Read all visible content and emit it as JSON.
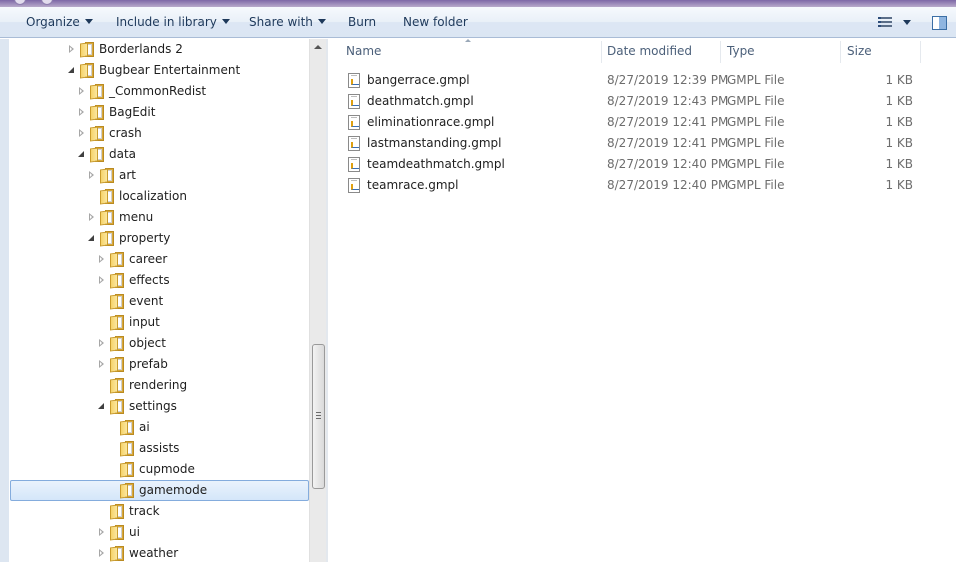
{
  "toolbar": {
    "organize": "Organize",
    "include_in_library": "Include in library",
    "share_with": "Share with",
    "burn": "Burn",
    "new_folder": "New folder"
  },
  "nav": {
    "items": [
      {
        "label": "Borderlands 2",
        "level": 0,
        "expander": "closed",
        "selected": false
      },
      {
        "label": "Bugbear Entertainment",
        "level": 0,
        "expander": "open",
        "selected": false
      },
      {
        "label": "_CommonRedist",
        "level": 1,
        "expander": "closed",
        "selected": false
      },
      {
        "label": "BagEdit",
        "level": 1,
        "expander": "closed",
        "selected": false
      },
      {
        "label": "crash",
        "level": 1,
        "expander": "closed",
        "selected": false
      },
      {
        "label": "data",
        "level": 1,
        "expander": "open",
        "selected": false
      },
      {
        "label": "art",
        "level": 2,
        "expander": "closed",
        "selected": false
      },
      {
        "label": "localization",
        "level": 2,
        "expander": "none",
        "selected": false
      },
      {
        "label": "menu",
        "level": 2,
        "expander": "closed",
        "selected": false
      },
      {
        "label": "property",
        "level": 2,
        "expander": "open",
        "selected": false
      },
      {
        "label": "career",
        "level": 3,
        "expander": "closed",
        "selected": false
      },
      {
        "label": "effects",
        "level": 3,
        "expander": "closed",
        "selected": false
      },
      {
        "label": "event",
        "level": 3,
        "expander": "none",
        "selected": false
      },
      {
        "label": "input",
        "level": 3,
        "expander": "none",
        "selected": false
      },
      {
        "label": "object",
        "level": 3,
        "expander": "closed",
        "selected": false
      },
      {
        "label": "prefab",
        "level": 3,
        "expander": "closed",
        "selected": false
      },
      {
        "label": "rendering",
        "level": 3,
        "expander": "none",
        "selected": false
      },
      {
        "label": "settings",
        "level": 3,
        "expander": "open",
        "selected": false
      },
      {
        "label": "ai",
        "level": 4,
        "expander": "none",
        "selected": false
      },
      {
        "label": "assists",
        "level": 4,
        "expander": "none",
        "selected": false
      },
      {
        "label": "cupmode",
        "level": 4,
        "expander": "none",
        "selected": false
      },
      {
        "label": "gamemode",
        "level": 4,
        "expander": "none",
        "selected": true
      },
      {
        "label": "track",
        "level": 3,
        "expander": "none",
        "selected": false
      },
      {
        "label": "ui",
        "level": 3,
        "expander": "closed",
        "selected": false
      },
      {
        "label": "weather",
        "level": 3,
        "expander": "closed",
        "selected": false
      }
    ]
  },
  "columns": {
    "name": "Name",
    "date_modified": "Date modified",
    "type": "Type",
    "size": "Size"
  },
  "files": [
    {
      "name": "bangerrace.gmpl",
      "date": "8/27/2019 12:39 PM",
      "type": "GMPL File",
      "size": "1 KB"
    },
    {
      "name": "deathmatch.gmpl",
      "date": "8/27/2019 12:43 PM",
      "type": "GMPL File",
      "size": "1 KB"
    },
    {
      "name": "eliminationrace.gmpl",
      "date": "8/27/2019 12:41 PM",
      "type": "GMPL File",
      "size": "1 KB"
    },
    {
      "name": "lastmanstanding.gmpl",
      "date": "8/27/2019 12:41 PM",
      "type": "GMPL File",
      "size": "1 KB"
    },
    {
      "name": "teamdeathmatch.gmpl",
      "date": "8/27/2019 12:40 PM",
      "type": "GMPL File",
      "size": "1 KB"
    },
    {
      "name": "teamrace.gmpl",
      "date": "8/27/2019 12:40 PM",
      "type": "GMPL File",
      "size": "1 KB"
    }
  ]
}
